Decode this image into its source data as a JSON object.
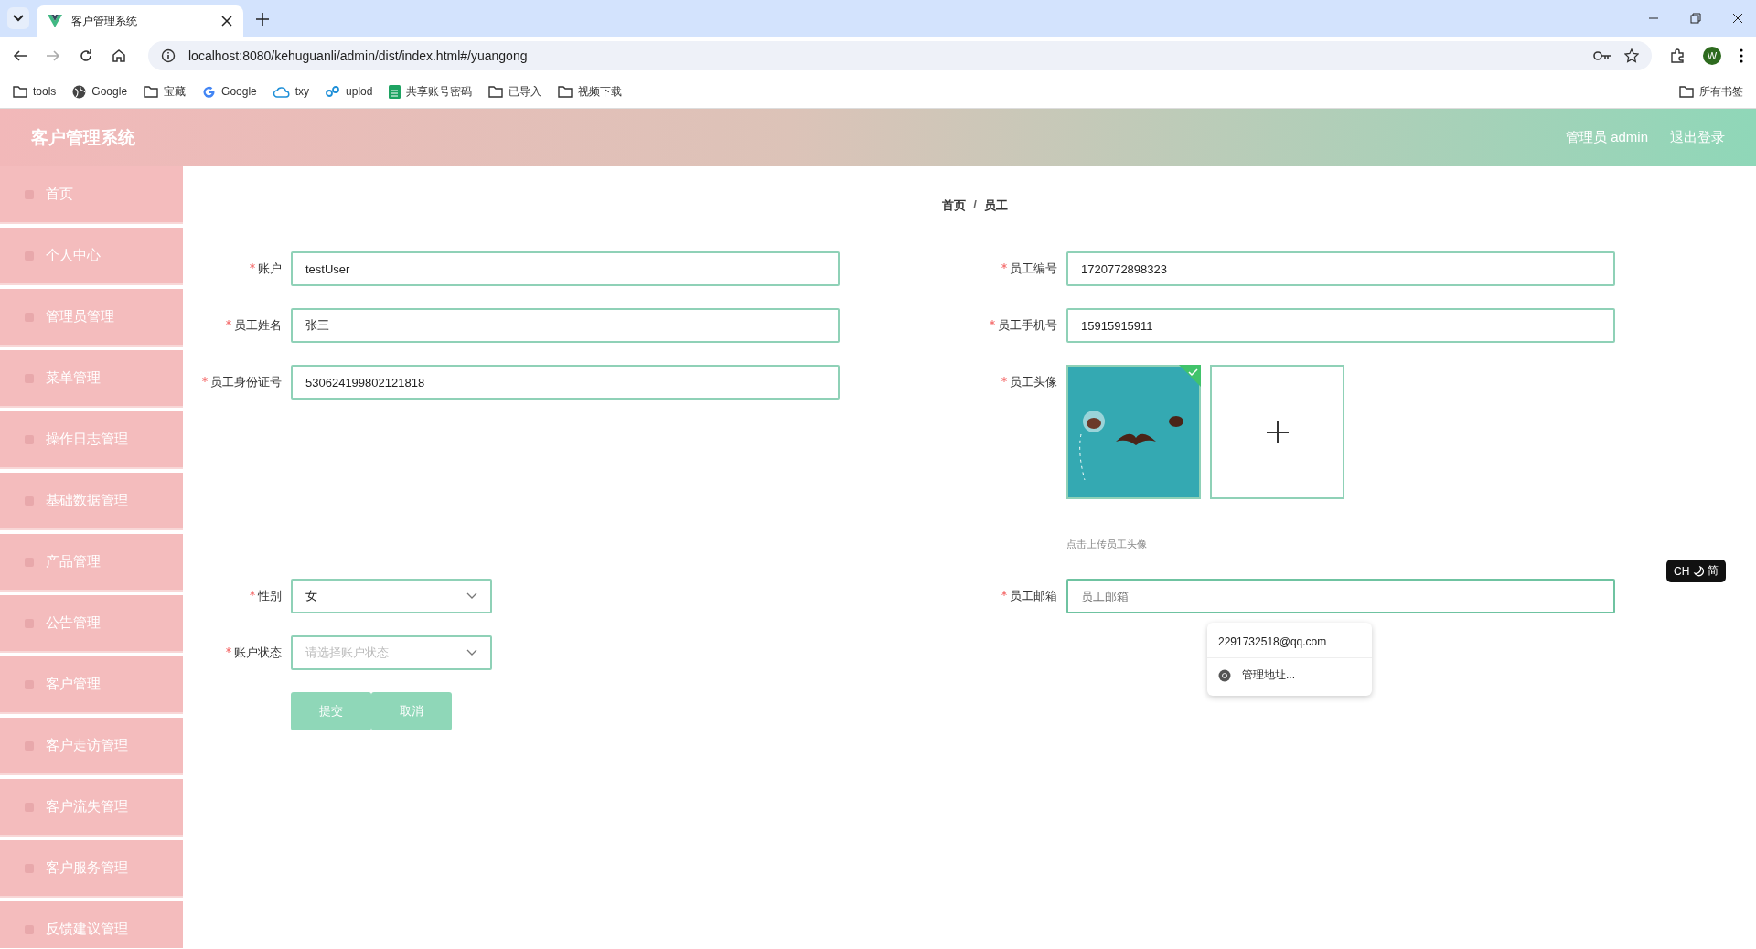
{
  "browser": {
    "tabs": [
      {
        "title": "客户管理系统",
        "selected": true
      }
    ],
    "url": "localhost:8080/kehuguanli/admin/dist/index.html#/yuangong",
    "profile": "W",
    "bookmarks": [
      {
        "kind": "folder",
        "label": "tools"
      },
      {
        "kind": "globe",
        "label": "Google"
      },
      {
        "kind": "folder",
        "label": "宝藏"
      },
      {
        "kind": "google",
        "label": "Google"
      },
      {
        "kind": "cloud",
        "label": "txy"
      },
      {
        "kind": "link",
        "label": "uplod"
      },
      {
        "kind": "sheet",
        "label": "共享账号密码"
      },
      {
        "kind": "folder",
        "label": "已导入"
      },
      {
        "kind": "folder",
        "label": "视频下载"
      }
    ],
    "all_bookmarks": "所有书签"
  },
  "header": {
    "title": "客户管理系统",
    "user": "管理员 admin",
    "logout": "退出登录"
  },
  "sidebar": {
    "items": [
      "首页",
      "个人中心",
      "管理员管理",
      "菜单管理",
      "操作日志管理",
      "基础数据管理",
      "产品管理",
      "公告管理",
      "客户管理",
      "客户走访管理",
      "客户流失管理",
      "客户服务管理",
      "反馈建议管理"
    ]
  },
  "breadcrumb": {
    "items": [
      "首页",
      "员工"
    ],
    "separator": "/"
  },
  "form": {
    "left": [
      {
        "kind": "text",
        "label": "账户",
        "required": true,
        "value": "testUser"
      },
      {
        "kind": "text",
        "label": "员工姓名",
        "required": true,
        "value": "张三"
      },
      {
        "kind": "text",
        "label": "员工身份证号",
        "required": true,
        "value": "530624199802121818"
      }
    ],
    "right": [
      {
        "kind": "text",
        "label": "员工编号",
        "required": true,
        "value": "1720772898323"
      },
      {
        "kind": "text",
        "label": "员工手机号",
        "required": true,
        "value": "15915915911"
      },
      {
        "kind": "upload",
        "label": "员工头像",
        "required": true,
        "uploaded": true,
        "hint": "点击上传员工头像"
      }
    ],
    "left2": [
      {
        "kind": "select",
        "label": "性别",
        "required": true,
        "value": "女"
      },
      {
        "kind": "select",
        "label": "账户状态",
        "required": true,
        "placeholder": "请选择账户状态"
      }
    ],
    "right2": [
      {
        "kind": "text",
        "label": "员工邮箱",
        "required": true,
        "placeholder": "员工邮箱",
        "focused": true
      }
    ],
    "buttons": [
      "提交",
      "取消"
    ]
  },
  "autofill": {
    "suggestion": "2291732518@qq.com",
    "manage": "管理地址..."
  },
  "ime": {
    "mode": "CH",
    "script": "简"
  }
}
